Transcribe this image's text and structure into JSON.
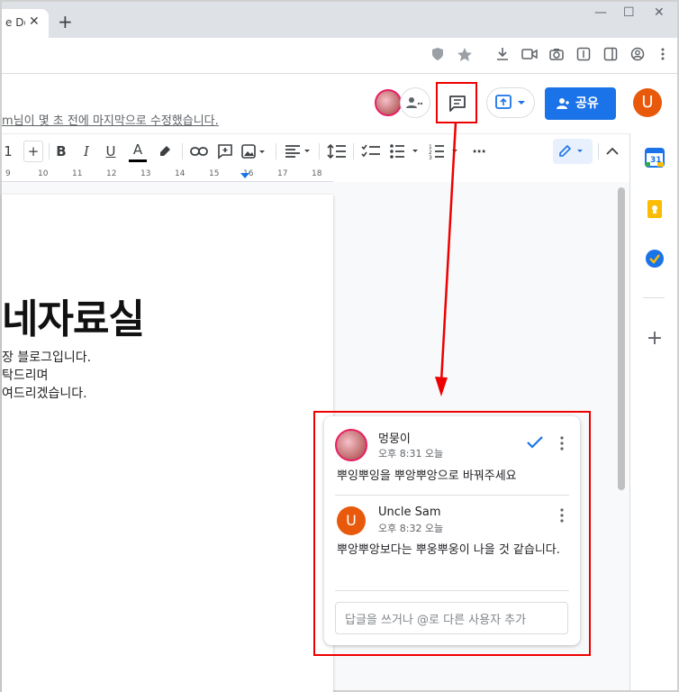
{
  "browser": {
    "tab_title": "e Do",
    "tab_close": "✕",
    "new_tab": "+",
    "minimize": "—",
    "maximize": "☐",
    "close": "✕"
  },
  "docs": {
    "last_edit": "m님이 몇 초 전에 마지막으로 수정했습니다.",
    "share_label": "공유",
    "user_initial": "U",
    "group_glyph": "⋯"
  },
  "toolbar": {
    "font_size": "1",
    "font_plus": "+",
    "bold": "B",
    "italic": "I",
    "underline": "U",
    "text_color": "A",
    "more": "⋯"
  },
  "ruler": {
    "ticks": [
      "9",
      "10",
      "11",
      "12",
      "13",
      "14",
      "15",
      "16",
      "17",
      "18"
    ]
  },
  "document": {
    "title": "네자료실",
    "lines": [
      "장 블로그입니다.",
      "탁드리며",
      "여드리겠습니다."
    ]
  },
  "comments": {
    "thread": [
      {
        "author": "멍뭉이",
        "time": "오후 8:31 오늘",
        "body": "뿌잉뿌잉을 뿌앙뿌앙으로 바꿔주세요"
      },
      {
        "author": "Uncle Sam",
        "avatar_initial": "U",
        "time": "오후 8:32 오늘",
        "body": "뿌앙뿌앙보다는 뿌웅뿌웅이 나을 것 같습니다."
      }
    ],
    "reply_placeholder": "답글을 쓰거나 @로 다른 사용자 추가"
  },
  "side_panel": {
    "calendar_label": "31",
    "add_label": "+"
  },
  "colors": {
    "accent": "#1a73e8",
    "highlight_red": "#ee0000",
    "user_orange": "#e8590c"
  }
}
